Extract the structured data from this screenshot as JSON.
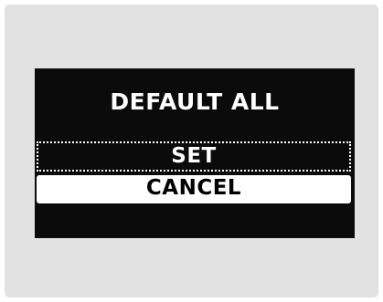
{
  "dialog": {
    "title": "DEFAULT ALL",
    "options": [
      {
        "label": "SET",
        "state": "focused"
      },
      {
        "label": "CANCEL",
        "state": "selected"
      }
    ]
  },
  "colors": {
    "frame": "#e2e2e2",
    "screen": "#0b0b0b",
    "text": "#ffffff",
    "highlight": "#ffffff"
  }
}
